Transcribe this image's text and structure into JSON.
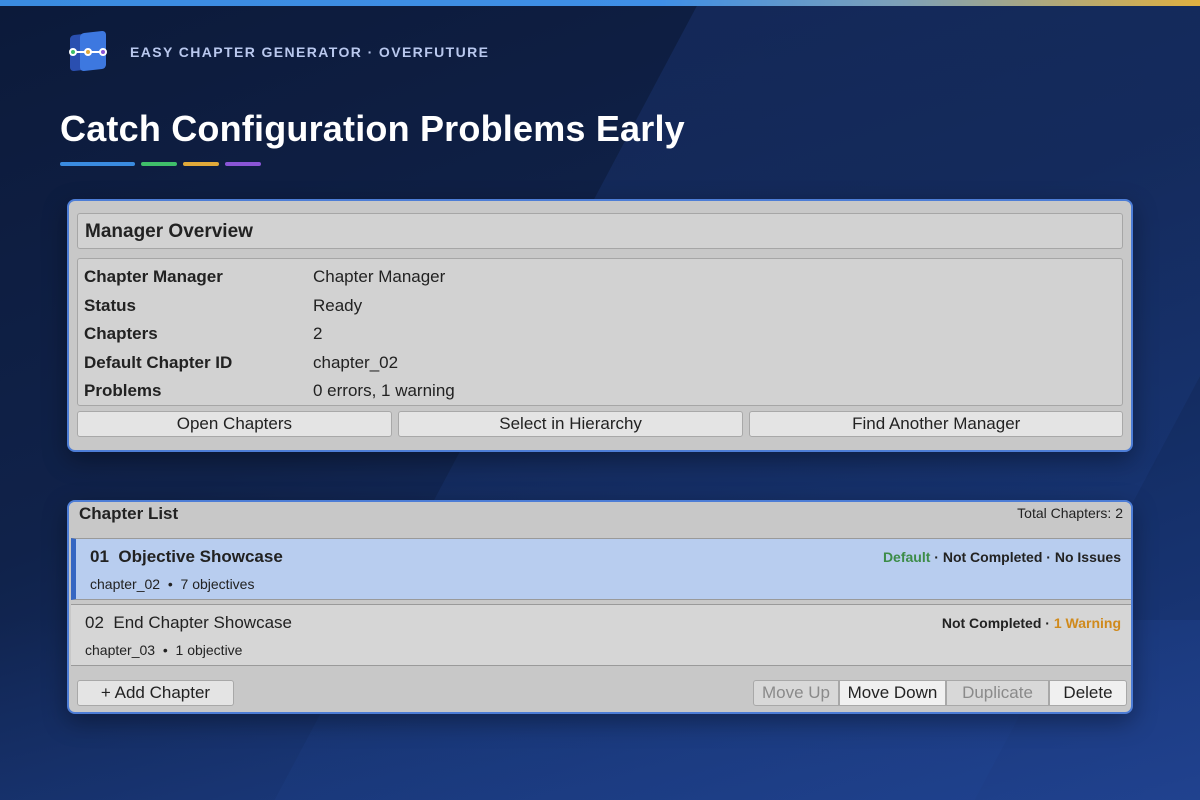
{
  "brand": {
    "logo_icon": "chapter-flow-icon",
    "text": "EASY CHAPTER GENERATOR · OVERFUTURE"
  },
  "headline": "Catch Configuration Problems Early",
  "accent_colors": [
    "#3a8be0",
    "#3fbf6a",
    "#e0a93a",
    "#8a55d6"
  ],
  "overview": {
    "title": "Manager Overview",
    "rows": [
      {
        "key": "Chapter Manager",
        "value": "Chapter Manager"
      },
      {
        "key": "Status",
        "value": "Ready"
      },
      {
        "key": "Chapters",
        "value": "2"
      },
      {
        "key": "Default Chapter ID",
        "value": "chapter_02"
      },
      {
        "key": "Problems",
        "value": "0 errors, 1 warning"
      }
    ],
    "buttons": {
      "open": "Open Chapters",
      "select": "Select in Hierarchy",
      "find": "Find Another Manager"
    }
  },
  "chapter_list": {
    "title": "Chapter List",
    "total": "Total Chapters: 2",
    "chapters": [
      {
        "number": "01",
        "name": "Objective Showcase",
        "id": "chapter_02",
        "separator": "•",
        "objectives": "7 objectives",
        "status_default": "Default",
        "status_sep": "·",
        "status_completed": "Not Completed",
        "status_issues": "No Issues"
      },
      {
        "number": "02",
        "name": "End Chapter Showcase",
        "id": "chapter_03",
        "separator": "•",
        "objectives": "1 objective",
        "status_sep": "·",
        "status_completed": "Not Completed",
        "status_issues": "1 Warning"
      }
    ],
    "add_label": "+ Add Chapter",
    "move_up": "Move Up",
    "move_down": "Move Down",
    "duplicate": "Duplicate",
    "delete": "Delete"
  },
  "colors": {
    "panel_border": "#4d7dd6",
    "selected_row": "#b8cdef",
    "default_status": "#3c8c48",
    "warning_status": "#d08a1c"
  }
}
